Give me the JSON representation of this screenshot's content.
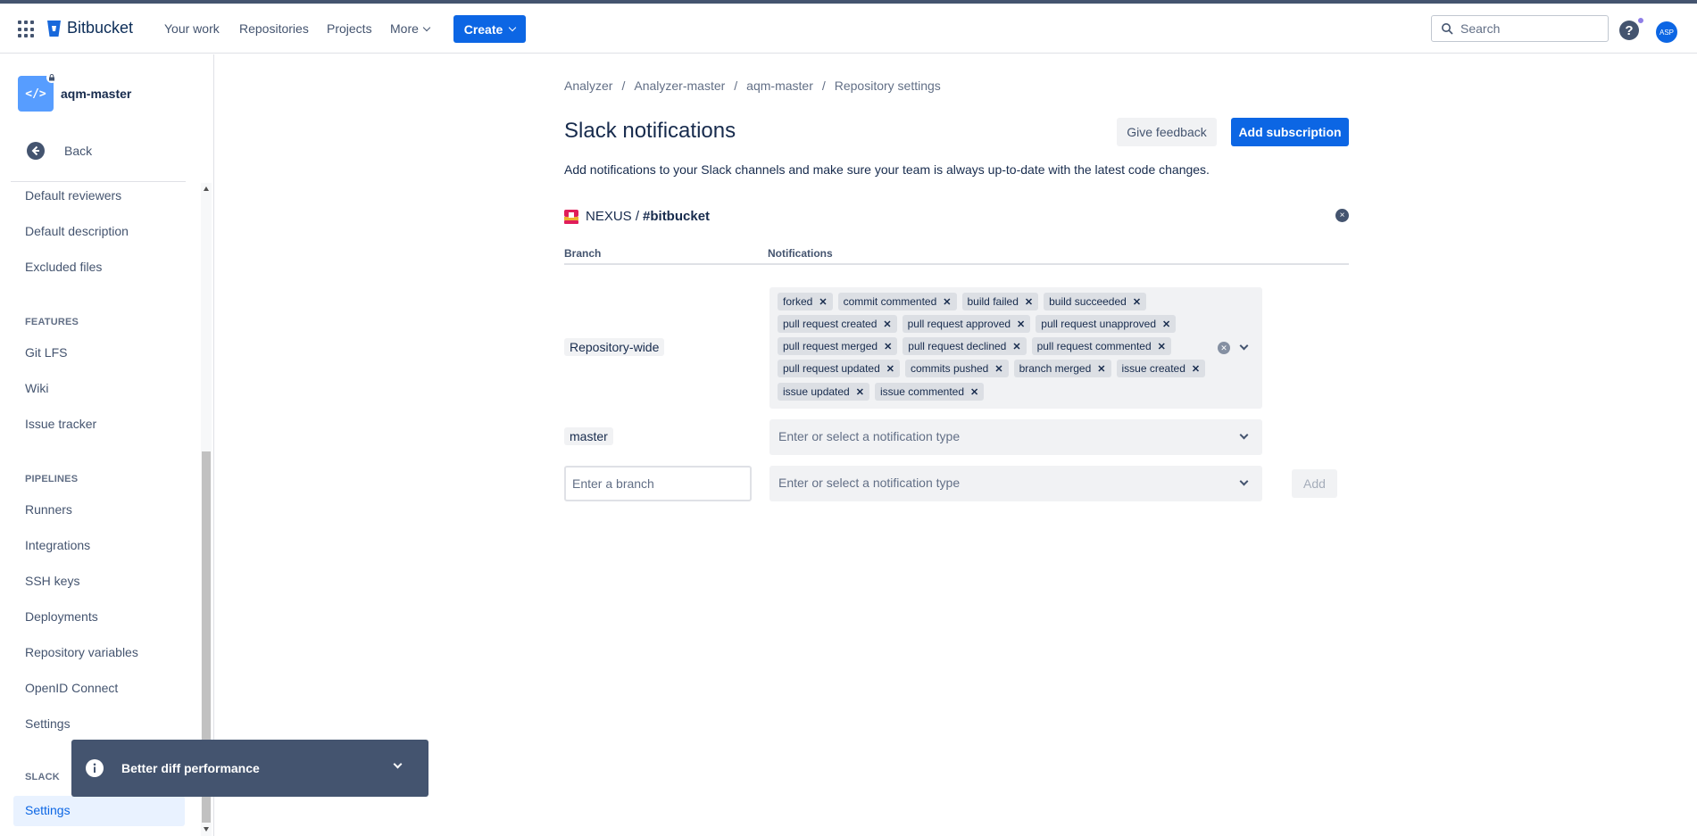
{
  "topnav": {
    "logo_text": "Bitbucket",
    "items": [
      "Your work",
      "Repositories",
      "Projects",
      "More"
    ],
    "create_label": "Create",
    "search_placeholder": "Search",
    "avatar_initials": "ASP"
  },
  "sidebar": {
    "repo_name": "aqm-master",
    "back_label": "Back",
    "items_top": [
      "Default reviewers",
      "Default description",
      "Excluded files"
    ],
    "features_title": "FEATURES",
    "features": [
      "Git LFS",
      "Wiki",
      "Issue tracker"
    ],
    "pipelines_title": "PIPELINES",
    "pipelines": [
      "Runners",
      "Integrations",
      "SSH keys",
      "Deployments",
      "Repository variables",
      "OpenID Connect",
      "Settings"
    ],
    "slack_title": "SLACK",
    "slack_items": [
      "Settings"
    ]
  },
  "toast": {
    "text": "Better diff performance"
  },
  "breadcrumb": [
    "Analyzer",
    "Analyzer-master",
    "aqm-master",
    "Repository settings"
  ],
  "page": {
    "title": "Slack notifications",
    "feedback_label": "Give feedback",
    "add_subscription_label": "Add subscription",
    "subtitle": "Add notifications to your Slack channels and make sure your team is always up-to-date with the latest code changes."
  },
  "subscription": {
    "workspace": "NEXUS /",
    "channel": "#bitbucket",
    "col_branch": "Branch",
    "col_notifications": "Notifications",
    "rows": [
      {
        "branch": "Repository-wide",
        "chips": [
          [
            "forked",
            "commit commented",
            "build failed",
            "build succeeded"
          ],
          [
            "pull request created",
            "pull request approved",
            "pull request unapproved"
          ],
          [
            "pull request merged",
            "pull request declined",
            "pull request commented"
          ],
          [
            "pull request updated",
            "commits pushed",
            "branch merged",
            "issue created"
          ],
          [
            "issue updated",
            "issue commented"
          ]
        ]
      },
      {
        "branch": "master",
        "placeholder": "Enter or select a notification type"
      }
    ],
    "new_row": {
      "branch_placeholder": "Enter a branch",
      "notification_placeholder": "Enter or select a notification type",
      "add_label": "Add"
    }
  },
  "colors": {
    "primary": "#0c66e4",
    "toast_bg": "#44546f",
    "text": "#172b4d"
  }
}
